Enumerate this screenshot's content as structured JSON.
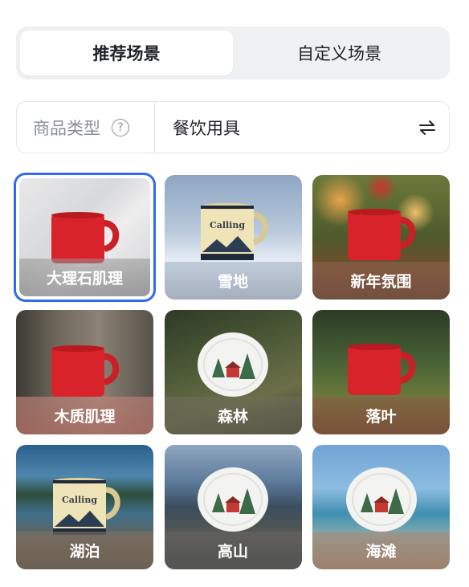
{
  "tabs": [
    {
      "label": "推荐场景",
      "active": true
    },
    {
      "label": "自定义场景",
      "active": false
    }
  ],
  "product_type": {
    "label": "商品类型",
    "help_icon": "question-circle-icon",
    "value": "餐饮用具",
    "swap_icon": "swap-arrows-icon"
  },
  "scenes": [
    {
      "name": "大理石肌理",
      "selected": true
    },
    {
      "name": "雪地",
      "selected": false
    },
    {
      "name": "新年氛围",
      "selected": false
    },
    {
      "name": "木质肌理",
      "selected": false
    },
    {
      "name": "森林",
      "selected": false
    },
    {
      "name": "落叶",
      "selected": false
    },
    {
      "name": "湖泊",
      "selected": false
    },
    {
      "name": "高山",
      "selected": false
    },
    {
      "name": "海滩",
      "selected": false
    }
  ],
  "colors": {
    "accent": "#2f6bf0",
    "mug_red": "#d8232a"
  }
}
